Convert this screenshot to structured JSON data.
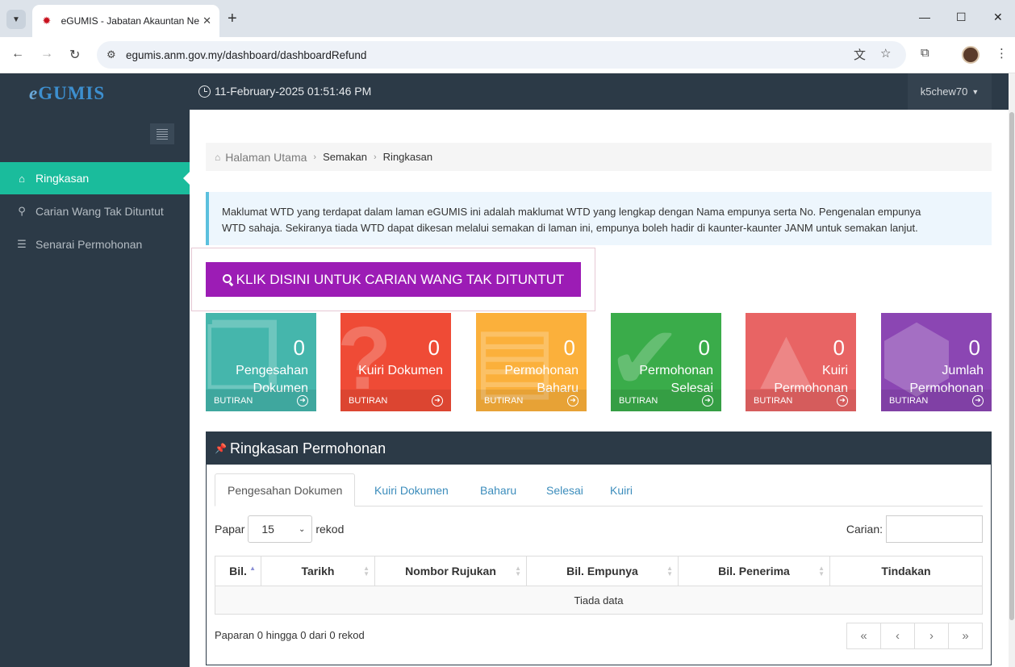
{
  "browser": {
    "tab_title": "eGUMIS - Jabatan Akauntan Ne",
    "url": "egumis.anm.gov.my/dashboard/dashboardRefund"
  },
  "app": {
    "logo_prefix": "e",
    "logo_rest": "GUMIS",
    "datetime": "11-February-2025 01:51:46 PM",
    "user": "k5chew70"
  },
  "sidebar": {
    "items": [
      {
        "label": "Ringkasan",
        "icon": "home-icon"
      },
      {
        "label": "Carian Wang Tak Dituntut",
        "icon": "search-icon"
      },
      {
        "label": "Senarai Permohonan",
        "icon": "list-icon"
      }
    ]
  },
  "breadcrumb": {
    "home": "Halaman Utama",
    "level1": "Semakan",
    "level2": "Ringkasan"
  },
  "notice": {
    "line1": "Maklumat WTD yang terdapat dalam laman eGUMIS ini adalah maklumat WTD yang lengkap dengan Nama empunya serta No. Pengenalan empunya",
    "line2": "WTD sahaja. Sekiranya tiada WTD dapat dikesan melalui semakan di laman ini, empunya boleh hadir di kaunter-kaunter JANM untuk semakan lanjut."
  },
  "cta": {
    "label": "KLIK DISINI UNTUK CARIAN WANG TAK DITUNTUT",
    "color": "#9c1cb5"
  },
  "tiles": [
    {
      "count": "0",
      "label": "Pengesahan Dokumen",
      "footer": "BUTIRAN",
      "color": "#45b6ac",
      "icon": "documents-icon"
    },
    {
      "count": "0",
      "label": "Kuiri Dokumen",
      "footer": "BUTIRAN",
      "color": "#ef4b36",
      "icon": "question-icon"
    },
    {
      "count": "0",
      "label": "Permohonan Baharu",
      "footer": "BUTIRAN",
      "color": "#fbb03b",
      "icon": "file-icon"
    },
    {
      "count": "0",
      "label": "Permohonan Selesai",
      "footer": "BUTIRAN",
      "color": "#3aac4a",
      "icon": "check-icon"
    },
    {
      "count": "0",
      "label": "Kuiri Permohonan",
      "footer": "BUTIRAN",
      "color": "#e86464",
      "icon": "warning-icon"
    },
    {
      "count": "0",
      "label": "Jumlah Permohonan",
      "footer": "BUTIRAN",
      "color": "#8b46b3",
      "icon": "cubes-icon"
    }
  ],
  "panel": {
    "title": "Ringkasan Permohonan",
    "tabs": [
      "Pengesahan Dokumen",
      "Kuiri Dokumen",
      "Baharu",
      "Selesai",
      "Kuiri"
    ],
    "length_prefix": "Papar",
    "length_value": "15",
    "length_suffix": "rekod",
    "search_label": "Carian:",
    "columns": [
      "Bil.",
      "Tarikh",
      "Nombor Rujukan",
      "Bil. Empunya",
      "Bil. Penerima",
      "Tindakan"
    ],
    "empty_text": "Tiada data",
    "info": "Paparan 0 hingga 0 dari 0 rekod",
    "pager": [
      "«",
      "‹",
      "›",
      "»"
    ]
  }
}
